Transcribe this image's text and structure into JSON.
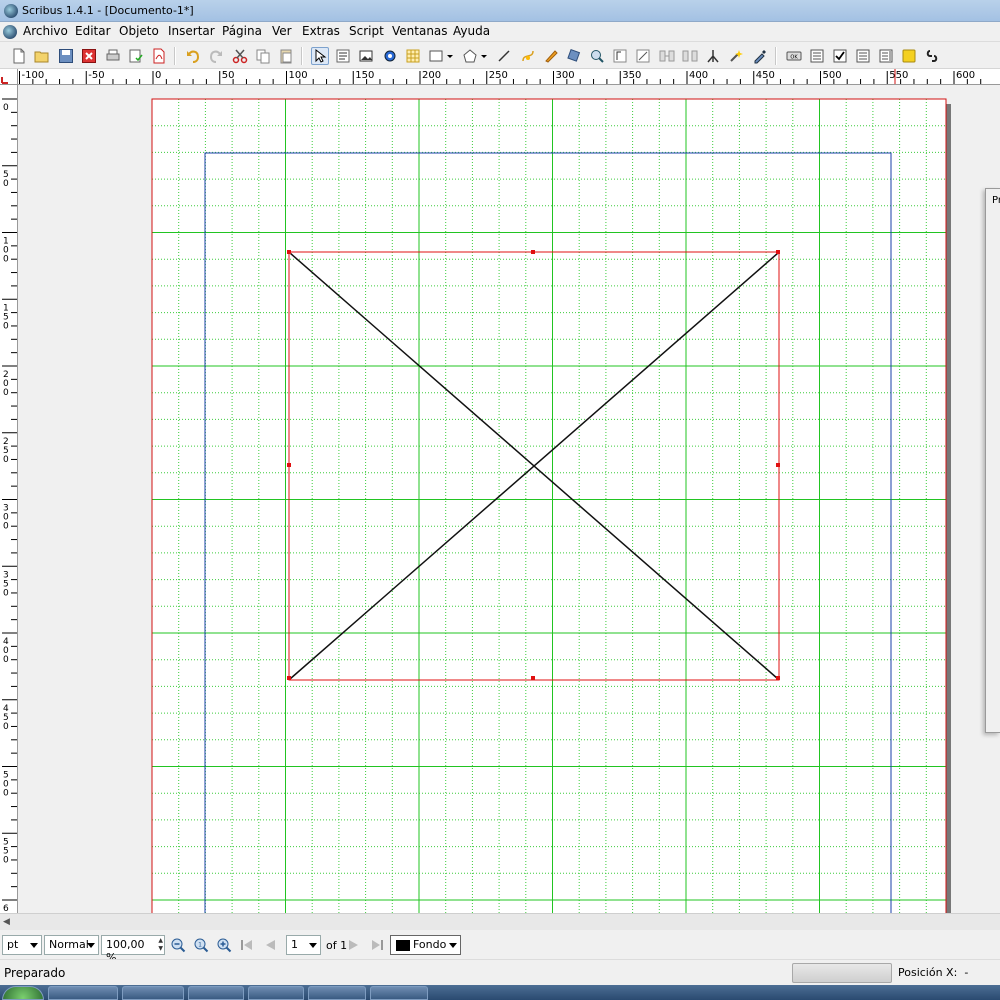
{
  "window": {
    "title": "Scribus 1.4.1 - [Documento-1*]"
  },
  "menubar": {
    "items": [
      "Archivo",
      "Editar",
      "Objeto",
      "Insertar",
      "Página",
      "Ver",
      "Extras",
      "Script",
      "Ventanas",
      "Ayuda"
    ]
  },
  "toolbar": {
    "icons": [
      "new-document-icon",
      "open-icon",
      "save-icon",
      "close-icon",
      "print-icon",
      "preflight-icon",
      "pdf-export-icon",
      "undo-icon",
      "redo-icon",
      "cut-icon",
      "copy-icon",
      "paste-icon",
      "select-icon",
      "text-frame-icon",
      "image-frame-icon",
      "render-frame-icon",
      "table-icon",
      "shape-icon",
      "polygon-icon",
      "line-icon",
      "bezier-icon",
      "freehand-icon",
      "rotate-icon",
      "zoom-icon",
      "edit-content-icon",
      "edit-text-icon",
      "link-frames-icon",
      "unlink-frames-icon",
      "measure-icon",
      "copy-properties-icon",
      "eyedropper-icon",
      "pdf-button-icon",
      "pdf-textfield-icon",
      "pdf-checkbox-icon",
      "pdf-combobox-icon",
      "pdf-listbox-icon",
      "pdf-annotation-icon",
      "pdf-link-icon"
    ]
  },
  "ruler_h": {
    "labels": [
      "-100",
      "-50",
      "0",
      "50",
      "100",
      "150",
      "200",
      "250",
      "300",
      "350",
      "400",
      "450",
      "500",
      "550",
      "600"
    ]
  },
  "ruler_v": {
    "labels": [
      "0",
      "50",
      "100",
      "150",
      "200",
      "250",
      "300",
      "350",
      "400",
      "450",
      "500",
      "550",
      "600"
    ]
  },
  "colors": {
    "grid_major": "#22c422",
    "grid_minor": "#3ccc3c",
    "page_border": "#d01010",
    "margin_guide": "#1a3fa8",
    "frame_border": "#e01010",
    "handle": "#e01010"
  },
  "controls": {
    "unit": "pt",
    "mode": "Normal",
    "zoom": "100,00 %",
    "page_current": "1",
    "page_of": "of 1",
    "layer": "Fondo"
  },
  "status": {
    "message": "Preparado",
    "position_label": "Posición X:",
    "position_value": "-"
  },
  "props_panel": {
    "title": "Pr"
  }
}
